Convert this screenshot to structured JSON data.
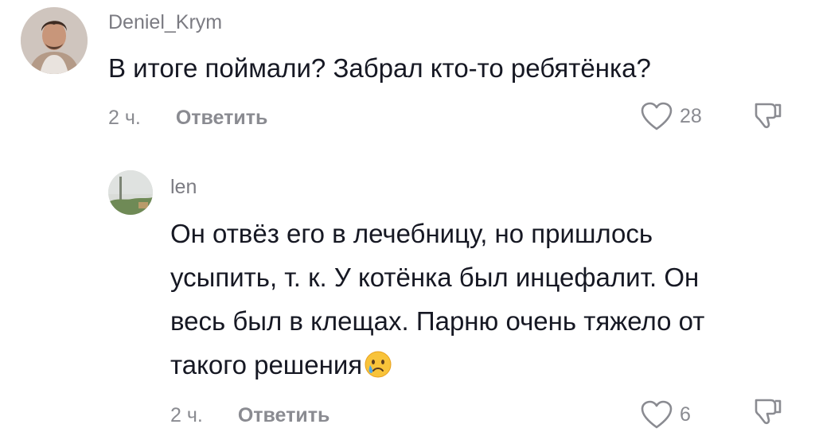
{
  "comments": [
    {
      "username": "Deniel_Krym",
      "text": "В итоге поймали? Забрал кто-то ребятёнка?",
      "time": "2 ч.",
      "reply_label": "Ответить",
      "likes": "28",
      "icons": {
        "like": "heart-outline-icon",
        "dislike": "thumbs-down-icon",
        "avatar": "profile-photo"
      }
    },
    {
      "username": "len",
      "text_lines": [
        "Он отвёз его в лечебницу, но пришлось",
        "усыпить, т. к. У котёнка был инцефалит. Он",
        "весь был в клещах. Парню очень тяжело от",
        "такого решения"
      ],
      "emoji": "crying-face-emoji",
      "time": "2 ч.",
      "reply_label": "Ответить",
      "likes": "6",
      "icons": {
        "like": "heart-outline-icon",
        "dislike": "thumbs-down-icon",
        "avatar": "profile-photo"
      }
    }
  ],
  "colors": {
    "text": "#161823",
    "muted": "#8a8b91",
    "username": "#7b7b82"
  }
}
